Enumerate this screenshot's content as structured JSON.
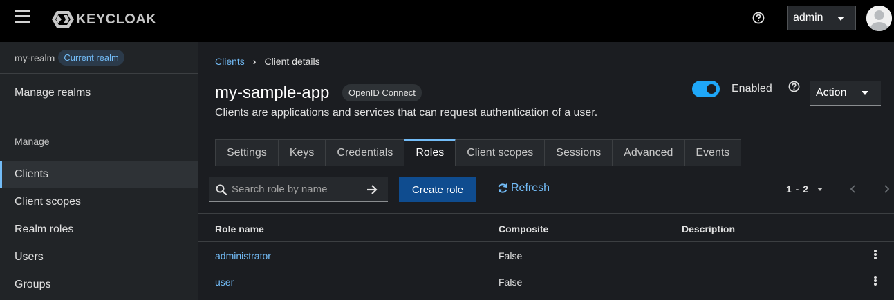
{
  "header": {
    "logo_text": "KEYCLOAK",
    "user_menu_label": "admin"
  },
  "sidebar": {
    "realm_name": "my-realm",
    "realm_badge": "Current realm",
    "manage_realms": "Manage realms",
    "section_label": "Manage",
    "items": [
      {
        "label": "Clients",
        "active": true
      },
      {
        "label": "Client scopes"
      },
      {
        "label": "Realm roles"
      },
      {
        "label": "Users"
      },
      {
        "label": "Groups"
      }
    ]
  },
  "breadcrumb": {
    "parent": "Clients",
    "current": "Client details"
  },
  "client": {
    "title": "my-sample-app",
    "protocol": "OpenID Connect",
    "description": "Clients are applications and services that can request authentication of a user.",
    "enabled_label": "Enabled",
    "enabled": true,
    "action_label": "Action"
  },
  "tabs": [
    {
      "label": "Settings"
    },
    {
      "label": "Keys"
    },
    {
      "label": "Credentials"
    },
    {
      "label": "Roles",
      "active": true
    },
    {
      "label": "Client scopes"
    },
    {
      "label": "Sessions"
    },
    {
      "label": "Advanced"
    },
    {
      "label": "Events"
    }
  ],
  "toolbar": {
    "search_placeholder": "Search role by name",
    "create_label": "Create role",
    "refresh_label": "Refresh",
    "pagination": "1 - 2"
  },
  "table": {
    "headers": [
      "Role name",
      "Composite",
      "Description"
    ],
    "rows": [
      {
        "name": "administrator",
        "composite": "False",
        "description": "–"
      },
      {
        "name": "user",
        "composite": "False",
        "description": "–"
      }
    ]
  },
  "colors": {
    "accent": "#73bcf7",
    "primary_button": "#0f4c8f",
    "switch_on": "#1fa7f8"
  }
}
